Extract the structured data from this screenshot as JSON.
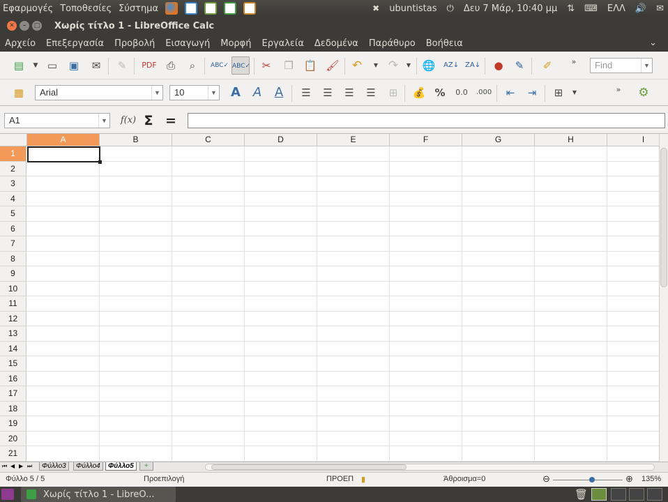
{
  "top_panel": {
    "menu": [
      "Εφαρμογές",
      "Τοποθεσίες",
      "Σύστημα"
    ],
    "user": "ubuntistas",
    "datetime": "Δευ 7 Μάρ, 10:40 μμ",
    "keyboard": "ΕΛΛ"
  },
  "window": {
    "title": "Χωρίς τίτλο 1 - LibreOffice Calc"
  },
  "menubar": [
    "Αρχείο",
    "Επεξεργασία",
    "Προβολή",
    "Εισαγωγή",
    "Μορφή",
    "Εργαλεία",
    "Δεδομένα",
    "Παράθυρο",
    "Βοήθεια"
  ],
  "toolbar": {
    "find_placeholder": "Find",
    "font_name": "Arial",
    "font_size": "10",
    "percent": "%",
    "decimal_label": ".000"
  },
  "formula_bar": {
    "name_box": "A1",
    "fx": "f(x)",
    "sigma": "Σ",
    "equals": "=",
    "input_value": ""
  },
  "grid": {
    "columns": [
      "A",
      "B",
      "C",
      "D",
      "E",
      "F",
      "G",
      "H",
      "I"
    ],
    "rows": [
      "1",
      "2",
      "3",
      "4",
      "5",
      "6",
      "7",
      "8",
      "9",
      "10",
      "11",
      "12",
      "13",
      "14",
      "15",
      "16",
      "17",
      "18",
      "19",
      "20",
      "21"
    ],
    "selected_cell": "A1"
  },
  "sheet_tabs": [
    "Φύλλο3",
    "Φύλλο4",
    "Φύλλο5"
  ],
  "active_tab": "Φύλλο5",
  "status": {
    "sheet": "Φύλλο 5 / 5",
    "page_style": "Προεπιλογή",
    "insert_mode": "ΠΡΟΕΠ",
    "sum": "Άθροισμα=0",
    "zoom": "135%"
  },
  "taskbar": {
    "app_button": "Χωρίς τίτλο 1 - LibreO..."
  },
  "colors": {
    "panel": "#3c3b37",
    "selected_header": "#f49a59",
    "window_close": "#f07746"
  }
}
